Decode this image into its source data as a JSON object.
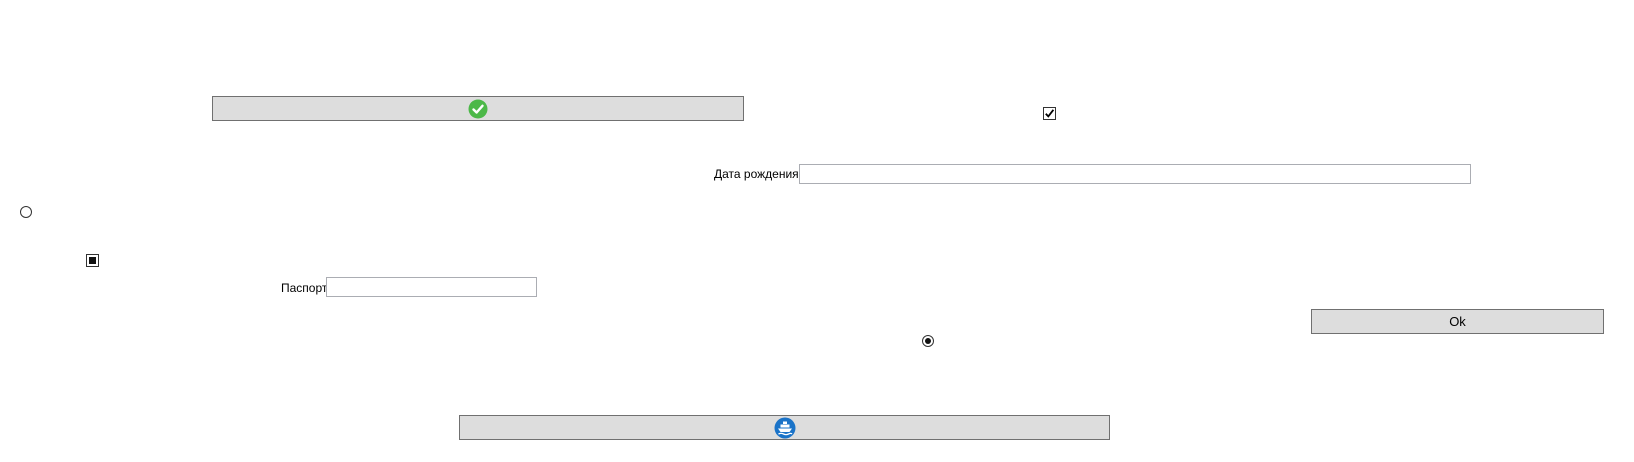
{
  "buttons": {
    "confirm": {
      "icon": "green-checkmark-icon",
      "accent": "#4cb848"
    },
    "ok": {
      "label": "Ok"
    },
    "ship": {
      "icon": "ship-icon",
      "accent": "#1a73c8"
    }
  },
  "checkboxes": {
    "checked": {
      "state": "checked"
    },
    "indeterminate": {
      "state": "indeterminate"
    }
  },
  "radios": {
    "unselected": {
      "state": "unselected"
    },
    "selected": {
      "state": "selected"
    }
  },
  "fields": {
    "birth_date": {
      "label": "Дата рождения",
      "value": ""
    },
    "passport": {
      "label": "Паспорт",
      "value": ""
    }
  }
}
